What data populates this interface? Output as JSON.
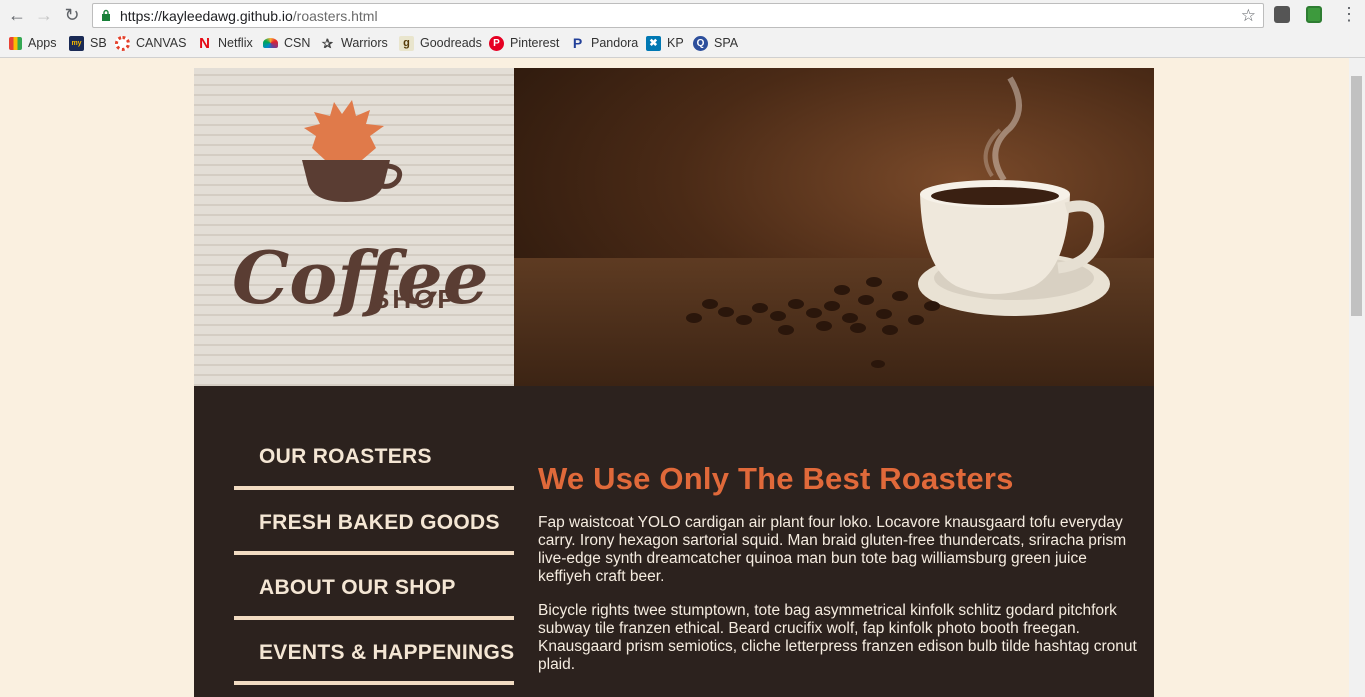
{
  "browser": {
    "url_host": "https://kayleedawg.github.io",
    "url_path": "/roasters.html",
    "bookmarks": [
      {
        "label": "Apps",
        "icon": "apps-grid-icon"
      },
      {
        "label": "SB",
        "icon": "mysb-icon"
      },
      {
        "label": "CANVAS",
        "icon": "canvas-icon"
      },
      {
        "label": "Netflix",
        "icon": "netflix-icon"
      },
      {
        "label": "CSN",
        "icon": "nbc-peacock-icon"
      },
      {
        "label": "Warriors",
        "icon": "warriors-icon"
      },
      {
        "label": "Goodreads",
        "icon": "goodreads-icon"
      },
      {
        "label": "Pinterest",
        "icon": "pinterest-icon"
      },
      {
        "label": "Pandora",
        "icon": "pandora-icon"
      },
      {
        "label": "KP",
        "icon": "kp-icon"
      },
      {
        "label": "SPA",
        "icon": "spa-icon"
      }
    ]
  },
  "logo": {
    "word": "Coffee",
    "sub": "SHOP"
  },
  "nav": [
    {
      "label": "OUR ROASTERS"
    },
    {
      "label": "FRESH BAKED GOODS"
    },
    {
      "label": "ABOUT OUR SHOP"
    },
    {
      "label": "EVENTS & HAPPENINGS"
    }
  ],
  "content": {
    "heading": "We Use Only The Best Roasters",
    "paragraphs": [
      "Fap waistcoat YOLO cardigan air plant four loko. Locavore knausgaard tofu everyday carry. Irony hexagon sartorial squid. Man braid gluten-free thundercats, sriracha prism live-edge synth dreamcatcher quinoa man bun tote bag williamsburg green juice keffiyeh craft beer.",
      "Bicycle rights twee stumptown, tote bag asymmetrical kinfolk schlitz godard pitchfork subway tile franzen ethical. Beard crucifix wolf, fap kinfolk photo booth freegan. Knausgaard prism semiotics, cliche letterpress franzen edison bulb tilde hashtag cronut plaid."
    ]
  },
  "colors": {
    "page_bg": "#faf0e0",
    "panel_bg": "#2c221e",
    "heading": "#e0693a",
    "nav_text": "#f4e6d4",
    "logo_brown": "#5a3d33",
    "logo_orange": "#e07a4a"
  }
}
